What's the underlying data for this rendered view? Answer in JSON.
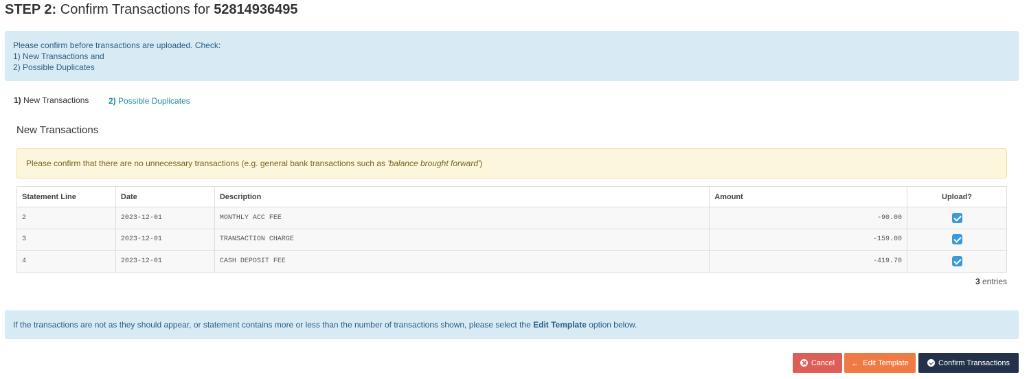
{
  "header": {
    "step_label": "STEP 2:",
    "title_text": " Confirm Transactions for ",
    "account_number": "52814936495"
  },
  "info_box": {
    "line1": "Please confirm before transactions are uploaded. Check:",
    "line2": "1) New Transactions and",
    "line3": "2) Possible Duplicates"
  },
  "tabs": [
    {
      "num": "1)",
      "label": " New Transactions",
      "active": true
    },
    {
      "num": "2)",
      "label": " Possible Duplicates",
      "active": false
    }
  ],
  "section_title": "New Transactions",
  "warning": {
    "text": "Please confirm that there are no unnecessary transactions (e.g. general bank transactions such as ",
    "italic": "'balance brought forward'",
    "suffix": ")"
  },
  "table": {
    "headers": [
      "Statement Line",
      "Date",
      "Description",
      "Amount",
      "Upload?"
    ],
    "rows": [
      {
        "line": "2",
        "date": "2023-12-01",
        "description": "MONTHLY ACC FEE",
        "amount": "-90.00",
        "upload": true
      },
      {
        "line": "3",
        "date": "2023-12-01",
        "description": "TRANSACTION CHARGE",
        "amount": "-159.00",
        "upload": true
      },
      {
        "line": "4",
        "date": "2023-12-01",
        "description": "CASH DEPOSIT FEE",
        "amount": "-419.70",
        "upload": true
      }
    ]
  },
  "entries": {
    "count": "3",
    "label": " entries"
  },
  "info_box2": {
    "text": "If the transactions are not as they should appear, or statement contains more or less than the number of transactions shown, please select the ",
    "bold": "Edit Template",
    "suffix": " option below."
  },
  "buttons": {
    "cancel": "Cancel",
    "edit_template": "Edit Template",
    "confirm": "Confirm Transactions"
  },
  "colors": {
    "info_bg": "#d8ebf5",
    "warn_bg": "#fcf7dc",
    "cancel": "#dd5d57",
    "edit": "#f07a45",
    "confirm": "#23324a",
    "checkbox": "#3d9ad9"
  },
  "icons": {
    "cancel": "times-circle-icon",
    "edit": "arrow-left-icon",
    "confirm": "check-circle-icon"
  }
}
